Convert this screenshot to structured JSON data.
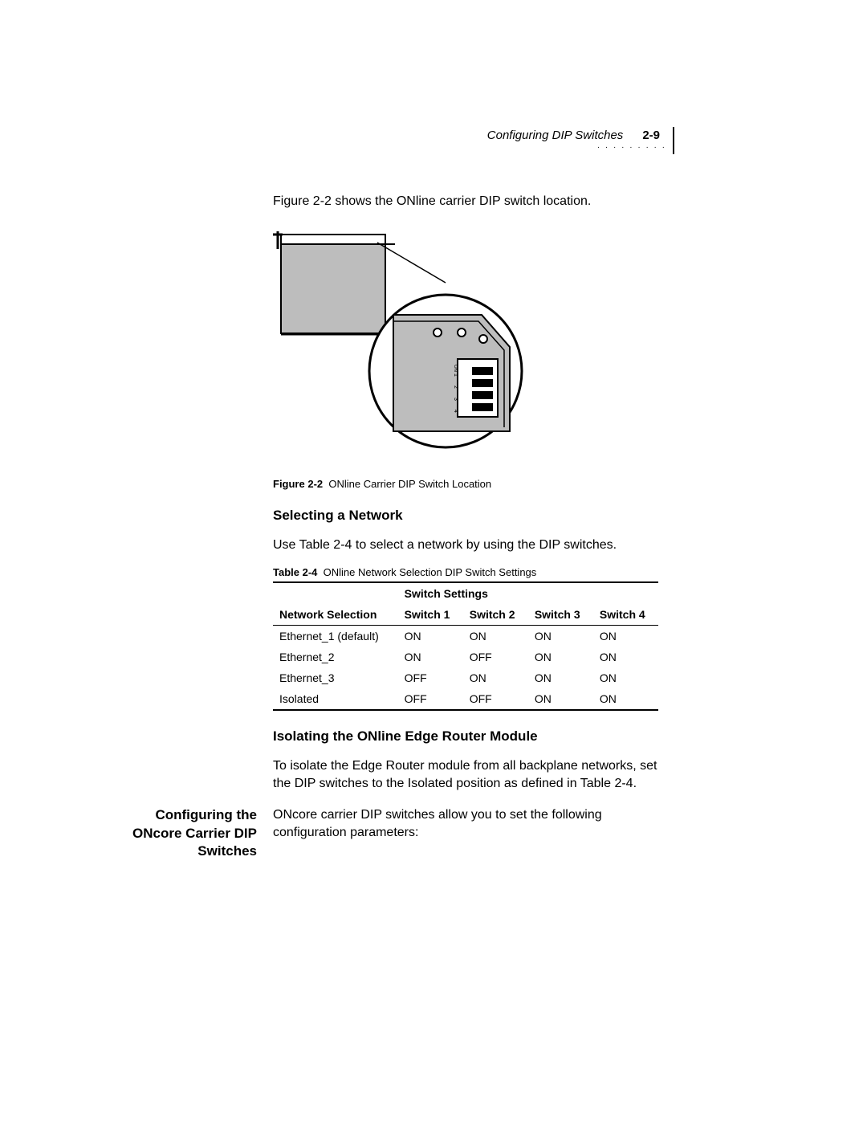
{
  "header": {
    "title": "Configuring DIP Switches",
    "page": "2-9"
  },
  "intro": "Figure 2-2 shows the ONline carrier DIP switch location.",
  "figure": {
    "label": "Figure 2-2",
    "caption": "ONline Carrier DIP Switch Location",
    "dip_labels": [
      "ON",
      "1",
      "2",
      "3",
      "4"
    ]
  },
  "section1": {
    "heading": "Selecting a Network",
    "para": "Use Table 2-4 to select a network by using the DIP switches."
  },
  "table": {
    "label": "Table 2-4",
    "caption": "ONline Network Selection DIP Switch Settings",
    "group_header": "Switch Settings",
    "columns": [
      "Network Selection",
      "Switch 1",
      "Switch 2",
      "Switch 3",
      "Switch 4"
    ],
    "rows": [
      {
        "name": "Ethernet_1 (default)",
        "s1": "ON",
        "s2": "ON",
        "s3": "ON",
        "s4": "ON"
      },
      {
        "name": "Ethernet_2",
        "s1": "ON",
        "s2": "OFF",
        "s3": "ON",
        "s4": "ON"
      },
      {
        "name": "Ethernet_3",
        "s1": "OFF",
        "s2": "ON",
        "s3": "ON",
        "s4": "ON"
      },
      {
        "name": "Isolated",
        "s1": "OFF",
        "s2": "OFF",
        "s3": "ON",
        "s4": "ON"
      }
    ]
  },
  "section2": {
    "heading": "Isolating the ONline Edge Router Module",
    "para": "To isolate the Edge Router module from all backplane networks, set the DIP switches to the Isolated position as defined in Table 2-4."
  },
  "section3": {
    "side_heading": "Configuring the ONcore Carrier DIP Switches",
    "para": "ONcore carrier DIP switches allow you to set the following configuration parameters:"
  }
}
